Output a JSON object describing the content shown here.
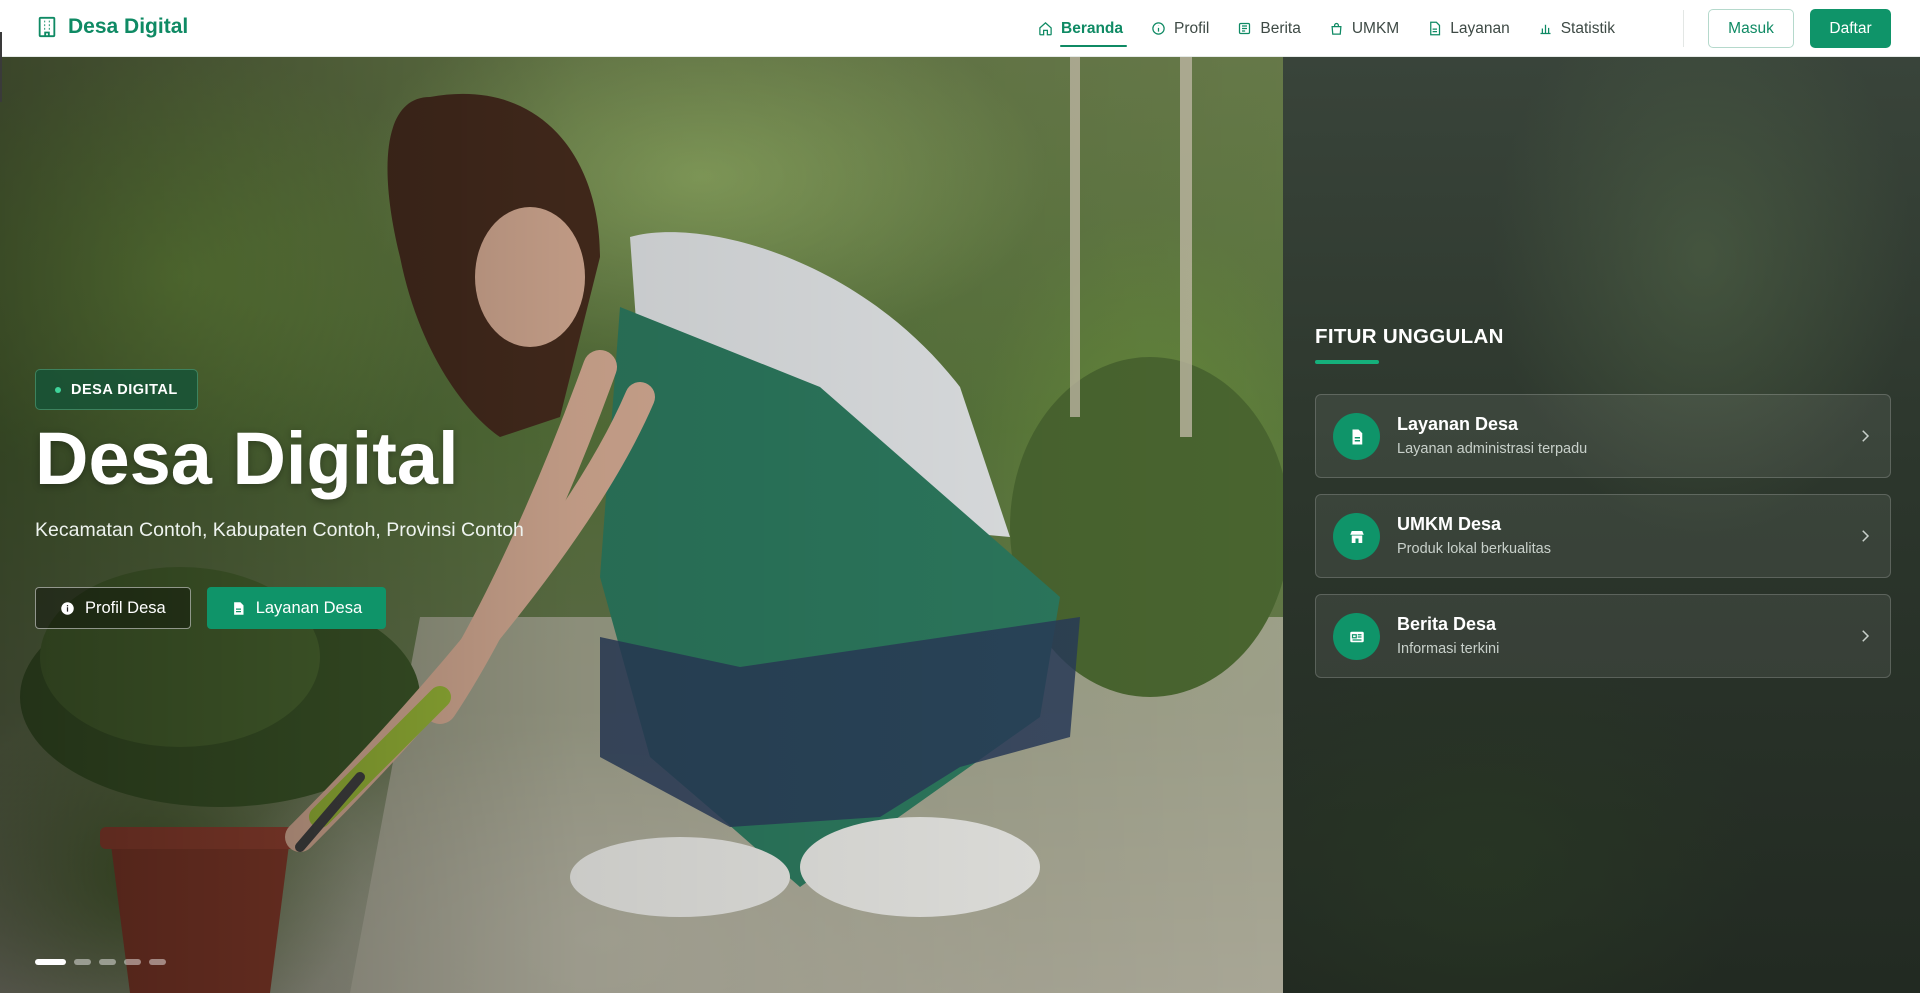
{
  "brand": {
    "name": "Desa Digital",
    "icon": "building-icon",
    "color": "#0f8a64"
  },
  "nav": {
    "items": [
      {
        "label": "Beranda",
        "icon": "home-icon",
        "active": true
      },
      {
        "label": "Profil",
        "icon": "info-icon",
        "active": false
      },
      {
        "label": "Berita",
        "icon": "newspaper-icon",
        "active": false
      },
      {
        "label": "UMKM",
        "icon": "shopping-bag-icon",
        "active": false
      },
      {
        "label": "Layanan",
        "icon": "document-icon",
        "active": false
      },
      {
        "label": "Statistik",
        "icon": "bar-chart-icon",
        "active": false
      }
    ],
    "login_label": "Masuk",
    "register_label": "Daftar"
  },
  "hero": {
    "badge": "DESA DIGITAL",
    "title": "Desa Digital",
    "subtitle": "Kecamatan Contoh, Kabupaten Contoh, Provinsi Contoh",
    "buttons": {
      "profile_label": "Profil Desa",
      "services_label": "Layanan Desa"
    },
    "slides": {
      "count": 5,
      "active": 1
    }
  },
  "features": {
    "heading": "FITUR UNGGULAN",
    "items": [
      {
        "title": "Layanan Desa",
        "description": "Layanan administrasi terpadu",
        "icon": "document-icon"
      },
      {
        "title": "UMKM Desa",
        "description": "Produk lokal berkualitas",
        "icon": "store-icon"
      },
      {
        "title": "Berita Desa",
        "description": "Informasi terkini",
        "icon": "newspaper-icon"
      }
    ]
  },
  "colors": {
    "primary": "#0f9469",
    "primary_text": "#0f8a64",
    "accent_underline": "#15b07b",
    "badge_dot": "#3fd39a"
  }
}
